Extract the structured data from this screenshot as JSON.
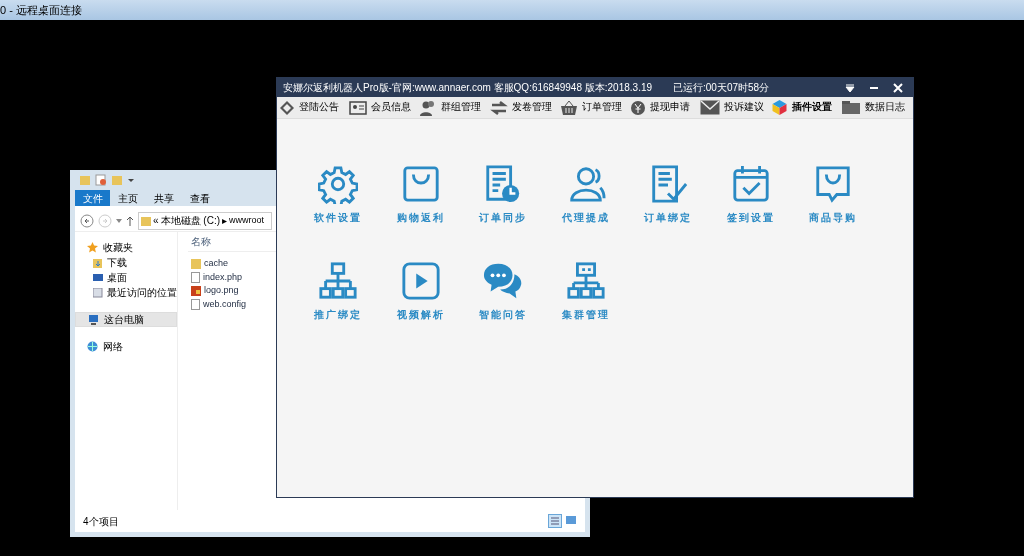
{
  "remote_window": {
    "title": "0 - 远程桌面连接"
  },
  "explorer": {
    "ribbon_tabs": [
      {
        "label": "文件",
        "selected": true
      },
      {
        "label": "主页",
        "selected": false
      },
      {
        "label": "共享",
        "selected": false
      },
      {
        "label": "查看",
        "selected": false
      }
    ],
    "address": {
      "prefix": "«",
      "drive": "本地磁盘 (C:)",
      "separator": "▸",
      "folder": "wwwroot"
    },
    "nav": [
      {
        "label": "收藏夹",
        "selected": false,
        "children": [
          {
            "label": "下载",
            "selected": false
          },
          {
            "label": "桌面",
            "selected": false
          },
          {
            "label": "最近访问的位置",
            "selected": false
          }
        ]
      },
      {
        "label": "这台电脑",
        "selected": true
      },
      {
        "label": "网络",
        "selected": false
      }
    ],
    "column_header": "名称",
    "files": [
      {
        "name": "cache",
        "kind": "folder"
      },
      {
        "name": "index.php",
        "kind": "file"
      },
      {
        "name": "logo.png",
        "kind": "image"
      },
      {
        "name": "web.config",
        "kind": "file"
      }
    ],
    "status": "4个项目"
  },
  "app": {
    "title": "安娜尔返利机器人Pro版-官网:www.annaer.com 客服QQ:616849948 版本:2018.3.19",
    "uptime": "已运行:00天07时58分",
    "toolbar": [
      {
        "label": "登陆公告",
        "selected": false
      },
      {
        "label": "会员信息",
        "selected": false
      },
      {
        "label": "群组管理",
        "selected": false
      },
      {
        "label": "发卷管理",
        "selected": false
      },
      {
        "label": "订单管理",
        "selected": false
      },
      {
        "label": "提现申请",
        "selected": false
      },
      {
        "label": "投诉建议",
        "selected": false
      },
      {
        "label": "插件设置",
        "selected": true
      },
      {
        "label": "数据日志",
        "selected": false
      }
    ],
    "tiles": [
      "软件设置",
      "购物返利",
      "订单同步",
      "代理提成",
      "订单绑定",
      "签到设置",
      "商品导购",
      "推广绑定",
      "视频解析",
      "智能问答",
      "集群管理"
    ]
  }
}
